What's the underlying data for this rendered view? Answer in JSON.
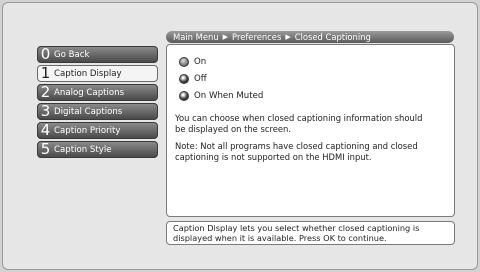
{
  "breadcrumb": {
    "items": [
      "Main Menu",
      "Preferences",
      "Closed Captioning"
    ]
  },
  "menu": {
    "items": [
      {
        "num": "0",
        "label": "Go Back",
        "selected": false
      },
      {
        "num": "1",
        "label": "Caption Display",
        "selected": true
      },
      {
        "num": "2",
        "label": "Analog Captions",
        "selected": false
      },
      {
        "num": "3",
        "label": "Digital Captions",
        "selected": false
      },
      {
        "num": "4",
        "label": "Caption Priority",
        "selected": false
      },
      {
        "num": "5",
        "label": "Caption Style",
        "selected": false
      }
    ]
  },
  "options": [
    {
      "label": "On",
      "state": "empty"
    },
    {
      "label": "Off",
      "state": "filled"
    },
    {
      "label": "On When Muted",
      "state": "filled"
    }
  ],
  "description": "You can choose when closed captioning information should be displayed on the screen.",
  "note": "Note: Not all programs have closed captioning and closed captioning is not supported on the HDMI input.",
  "help": "Caption Display lets you select whether closed captioning is displayed when it is available. Press OK to continue."
}
